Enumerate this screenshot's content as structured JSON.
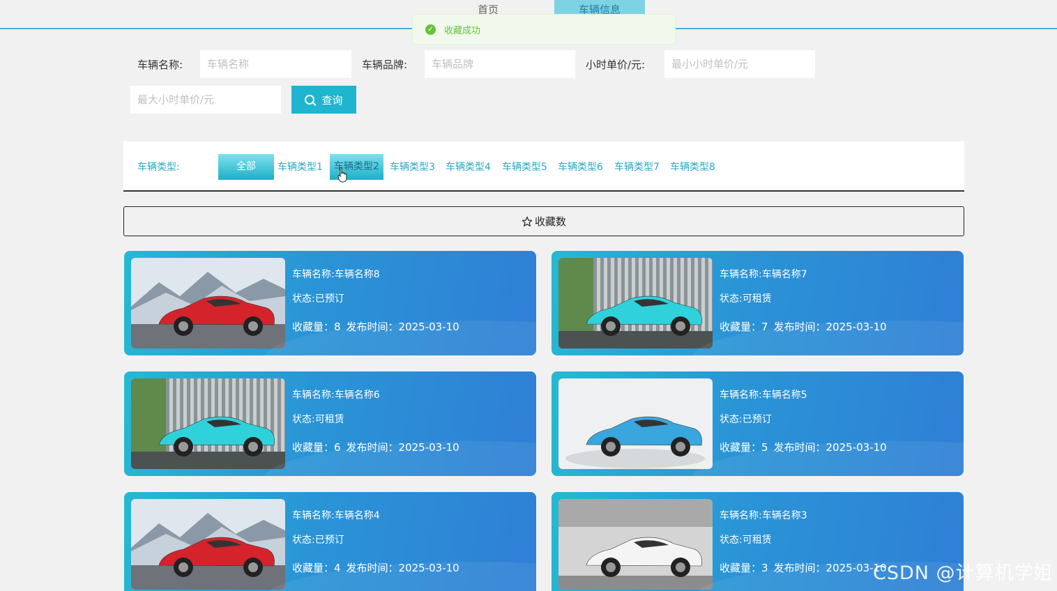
{
  "nav": {
    "home": "首页",
    "cars": "车辆信息"
  },
  "toast": {
    "message": "收藏成功"
  },
  "search": {
    "name_label": "车辆名称:",
    "name_placeholder": "车辆名称",
    "brand_label": "车辆品牌:",
    "brand_placeholder": "车辆品牌",
    "price_label": "小时单价/元:",
    "min_placeholder": "最小小时单价/元",
    "max_placeholder": "最大小时单价/元",
    "button": "查询"
  },
  "types": {
    "label": "车辆类型:",
    "all": "全部",
    "items": [
      "车辆类型1",
      "车辆类型2",
      "车辆类型3",
      "车辆类型4",
      "车辆类型5",
      "车辆类型6",
      "车辆类型7",
      "车辆类型8"
    ]
  },
  "sort": {
    "label": "收藏数"
  },
  "cards": [
    {
      "name": "车辆名称:车辆名称8",
      "status": "状态:已预订",
      "fav": "收藏量：8",
      "date": "发布时间：2025-03-10",
      "car_color": "#d4232b",
      "bg": "mountain"
    },
    {
      "name": "车辆名称:车辆名称7",
      "status": "状态:可租赁",
      "fav": "收藏量：7",
      "date": "发布时间：2025-03-10",
      "car_color": "#2fd2db",
      "bg": "wall"
    },
    {
      "name": "车辆名称:车辆名称6",
      "status": "状态:可租赁",
      "fav": "收藏量：6",
      "date": "发布时间：2025-03-10",
      "car_color": "#2fd2db",
      "bg": "wall"
    },
    {
      "name": "车辆名称:车辆名称5",
      "status": "状态:已预订",
      "fav": "收藏量：5",
      "date": "发布时间：2025-03-10",
      "car_color": "#3aa6de",
      "bg": "studio"
    },
    {
      "name": "车辆名称:车辆名称4",
      "status": "状态:已预订",
      "fav": "收藏量：4",
      "date": "发布时间：2025-03-10",
      "car_color": "#d4232b",
      "bg": "mountain"
    },
    {
      "name": "车辆名称:车辆名称3",
      "status": "状态:可租赁",
      "fav": "收藏量：3",
      "date": "发布时间：2025-03-10",
      "car_color": "#f4f4f4",
      "bg": "showroom"
    }
  ],
  "watermark": "CSDN @计算机学姐"
}
